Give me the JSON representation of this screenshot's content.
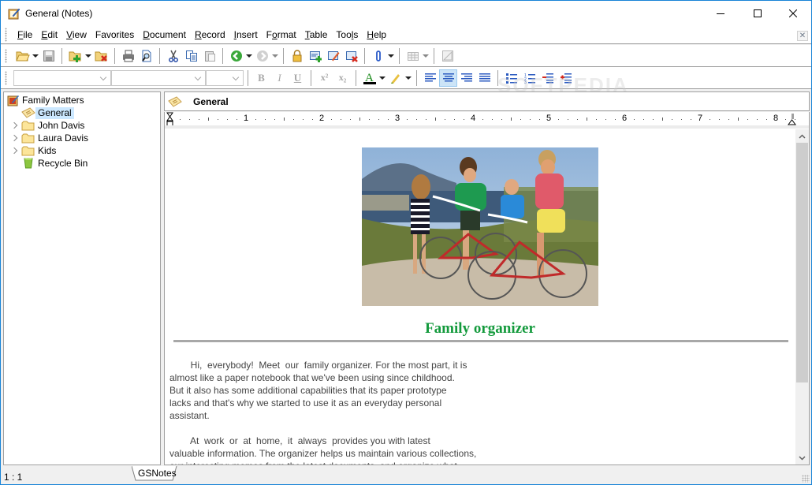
{
  "window": {
    "title": "General (Notes)",
    "controls": {
      "minimize": "minimize",
      "maximize": "maximize",
      "close": "close"
    }
  },
  "menu": {
    "items": [
      {
        "label": "File",
        "accel": "F"
      },
      {
        "label": "Edit",
        "accel": "E"
      },
      {
        "label": "View",
        "accel": "V"
      },
      {
        "label": "Favorites",
        "accel": ""
      },
      {
        "label": "Document",
        "accel": "D"
      },
      {
        "label": "Record",
        "accel": "R"
      },
      {
        "label": "Insert",
        "accel": "I"
      },
      {
        "label": "Format",
        "accel": "o"
      },
      {
        "label": "Table",
        "accel": "T"
      },
      {
        "label": "Tools",
        "accel": "l"
      },
      {
        "label": "Help",
        "accel": "H"
      }
    ]
  },
  "toolbar": {
    "buttons": [
      "open-folder",
      "save",
      "new-folder",
      "delete-folder",
      "print",
      "print-preview",
      "cut",
      "copy",
      "paste",
      "back",
      "forward",
      "lock",
      "new-record",
      "edit-record",
      "delete-record",
      "attachment",
      "insert-table",
      "drawing"
    ]
  },
  "format_toolbar": {
    "font_name": "",
    "font_size_style": "",
    "font_size": "",
    "bold": "B",
    "italic": "I",
    "underline": "U",
    "superscript": "x²",
    "subscript": "x₂",
    "font_color": "A",
    "font_color_hex": "#1a8a1a",
    "alignment_active": "center"
  },
  "tree": {
    "root": "Family Matters",
    "items": [
      {
        "label": "General",
        "icon": "note-icon",
        "selected": true,
        "expandable": false
      },
      {
        "label": "John Davis",
        "icon": "folder-icon",
        "selected": false,
        "expandable": true
      },
      {
        "label": "Laura Davis",
        "icon": "folder-icon",
        "selected": false,
        "expandable": true
      },
      {
        "label": "Kids",
        "icon": "folder-icon",
        "selected": false,
        "expandable": true
      },
      {
        "label": "Recycle Bin",
        "icon": "recycle-bin-icon",
        "selected": false,
        "expandable": false
      }
    ]
  },
  "document": {
    "title": "General",
    "ruler_numbers": [
      "1",
      "2",
      "3",
      "4",
      "5",
      "6",
      "7",
      "8"
    ],
    "image_alt": "Family with bicycles",
    "heading": "Family organizer",
    "heading_color": "#139a3c",
    "paragraph1": [
      "        Hi,  everybody!  Meet  our  family organizer. For the most part, it is",
      "almost  like  a  paper notebook that we've been using since childhood.",
      "But it also has some additional capabilities that its paper prototype",
      "lacks  and  that's  why  we  started to use it as an everyday personal",
      "assistant."
    ],
    "paragraph2": [
      "        At  work  or  at  home,  it  always  provides you with latest",
      "valuable information. The organizer helps us maintain various collections,",
      "our interesting memos from the latest documents, and organize what"
    ]
  },
  "status": {
    "position": "1 : 1",
    "tab": "GSNotes"
  },
  "watermark": "SOFTPEDIA"
}
